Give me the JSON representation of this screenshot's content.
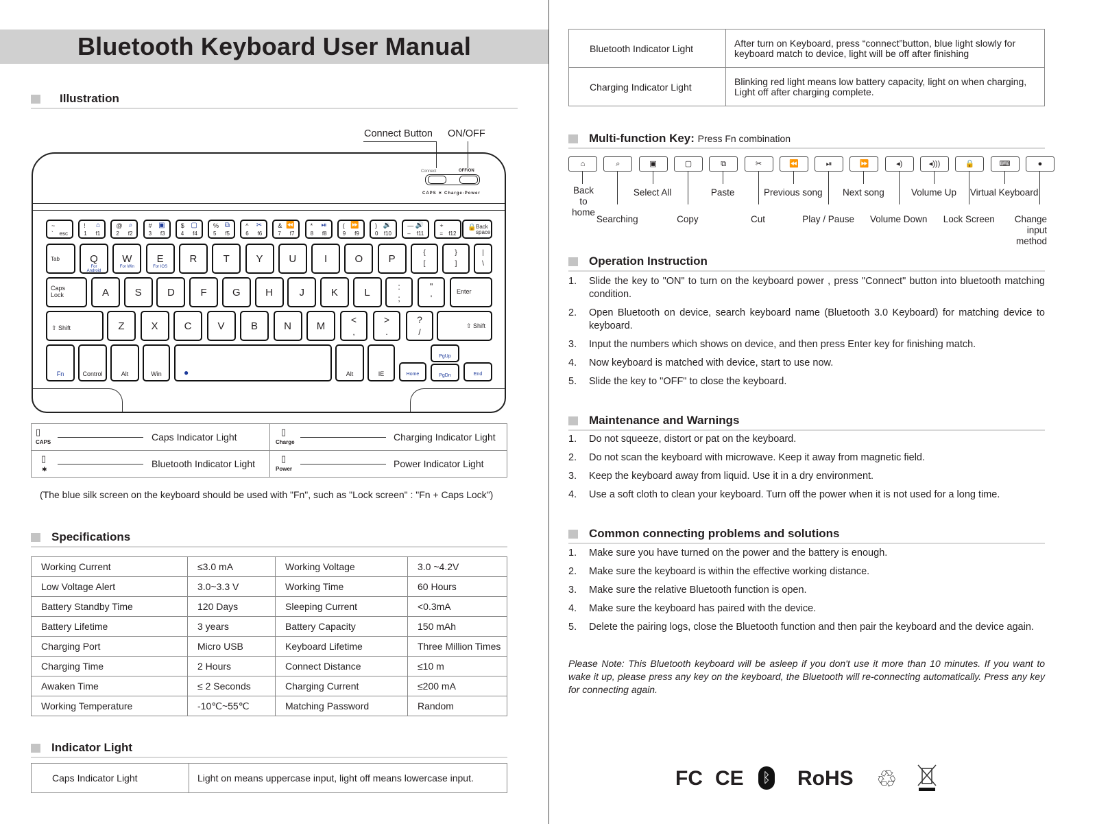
{
  "title": "Bluetooth Keyboard User Manual",
  "sections": {
    "illustration": "Illustration",
    "specifications": "Specifications",
    "indicator_light": "Indicator Light",
    "multi_function": "Multi-function Key:",
    "multi_function_sub": "Press Fn combination",
    "operation": "Operation Instruction",
    "maintenance": "Maintenance and Warnings",
    "problems": "Common connecting problems and solutions"
  },
  "illustration": {
    "callouts": {
      "connect": "Connect Button",
      "onoff": "ON/OFF"
    },
    "device_labels": {
      "connect": "Connect",
      "offon": "OFF/ON",
      "caps": "CAPS",
      "bt": "✶",
      "charge": "Charge",
      "power": "Power"
    },
    "indicator_legend": [
      {
        "code": "CAPS",
        "label": "Caps Indicator Light"
      },
      {
        "code": "Charge",
        "label": "Charging Indicator Light"
      },
      {
        "code": "✱",
        "label": "Bluetooth Indicator Light"
      },
      {
        "code": "Power",
        "label": "Power Indicator Light"
      }
    ],
    "note": "(The blue silk screen on the keyboard should be used with \"Fn\", such as \"Lock screen\" : \"Fn + Caps Lock\")"
  },
  "keyboard": {
    "row1": [
      {
        "top": "~",
        "bot": "`",
        "fn": "esc"
      },
      {
        "top": "!",
        "bot": "1",
        "fn": "f1",
        "icon": "⌂"
      },
      {
        "top": "@",
        "bot": "2",
        "fn": "f2",
        "icon": "⌕"
      },
      {
        "top": "#",
        "bot": "3",
        "fn": "f3",
        "icon": "▣"
      },
      {
        "top": "$",
        "bot": "4",
        "fn": "f4",
        "icon": "▢"
      },
      {
        "top": "%",
        "bot": "5",
        "fn": "f5",
        "icon": "⧉"
      },
      {
        "top": "^",
        "bot": "6",
        "fn": "f6",
        "icon": "✂"
      },
      {
        "top": "&",
        "bot": "7",
        "fn": "f7",
        "icon": "⏪"
      },
      {
        "top": "*",
        "bot": "8",
        "fn": "f8",
        "icon": "⏯"
      },
      {
        "top": "(",
        "bot": "9",
        "fn": "f9",
        "icon": "⏩"
      },
      {
        "top": ")",
        "bot": "0",
        "fn": "f10",
        "icon": "🔉"
      },
      {
        "top": "—",
        "bot": "–",
        "fn": "f11",
        "icon": "🔊"
      },
      {
        "top": "+",
        "bot": "=",
        "fn": "f12"
      }
    ],
    "backspace": "Back space",
    "row2": [
      "Q",
      "W",
      "E",
      "R",
      "T",
      "Y",
      "U",
      "I",
      "O",
      "P"
    ],
    "row2_sub": [
      "For Android",
      "For Win",
      "For IOS"
    ],
    "row2_extra": [
      {
        "top": "{",
        "bot": "["
      },
      {
        "top": "}",
        "bot": "]"
      },
      {
        "top": "|",
        "bot": "\\"
      }
    ],
    "tab": "Tab",
    "row3": [
      "A",
      "S",
      "D",
      "F",
      "G",
      "H",
      "J",
      "K",
      "L"
    ],
    "row3_extra": [
      {
        "top": ":",
        "bot": ";"
      },
      {
        "top": "\"",
        "bot": "'"
      }
    ],
    "caps": "Caps Lock",
    "enter": "Enter",
    "row4": [
      "Z",
      "X",
      "C",
      "V",
      "B",
      "N",
      "M"
    ],
    "row4_extra": [
      {
        "top": "<",
        "bot": ","
      },
      {
        "top": ">",
        "bot": "."
      },
      {
        "top": "?",
        "bot": "/"
      }
    ],
    "shift": "Shift",
    "row5": {
      "fn": "Fn",
      "control": "Control",
      "alt": "Alt",
      "win": "Win",
      "alt2": "Alt",
      "ie": "IE",
      "home": "Home",
      "pgup": "PgUp",
      "pgdn": "PgDn",
      "end": "End"
    }
  },
  "specifications": [
    [
      "Working Current",
      "≤3.0 mA",
      "Working Voltage",
      "3.0 ~4.2V"
    ],
    [
      "Low Voltage Alert",
      "3.0~3.3 V",
      "Working Time",
      "60 Hours"
    ],
    [
      "Battery Standby Time",
      "120 Days",
      "Sleeping Current",
      " <0.3mA"
    ],
    [
      "Battery Lifetime",
      "3 years",
      "Battery Capacity",
      "150 mAh"
    ],
    [
      "Charging Port",
      "Micro USB",
      "Keyboard Lifetime",
      "Three Million Times"
    ],
    [
      "Charging Time",
      "2 Hours",
      "Connect Distance",
      "≤10 m"
    ],
    [
      "Awaken Time",
      "≤ 2 Seconds",
      "Charging Current",
      "≤200 mA"
    ],
    [
      "Working Temperature",
      "-10℃~55℃",
      "Matching Password",
      "Random"
    ]
  ],
  "indicator_table": [
    [
      "Caps Indicator Light",
      "Light on means uppercase input, light off means lowercase input."
    ],
    [
      "Bluetooth Indicator Light",
      "After turn on Keyboard, press “connect”button, blue light slowly for keyboard match to device, light will be off after finishing"
    ],
    [
      "Charging Indicator Light",
      "Blinking red light means low battery capacity, light on when charging, Light off after charging complete."
    ]
  ],
  "multi_function_keys": [
    {
      "icon": "⌂",
      "label": "Back to home",
      "row": "top"
    },
    {
      "icon": "⌕",
      "label": "Searching",
      "row": "bottom"
    },
    {
      "icon": "▣",
      "label": "Select All",
      "row": "top"
    },
    {
      "icon": "▢",
      "label": "Copy",
      "row": "bottom"
    },
    {
      "icon": "⧉",
      "label": "Paste",
      "row": "top"
    },
    {
      "icon": "✂",
      "label": "Cut",
      "row": "bottom"
    },
    {
      "icon": "⏪",
      "label": "Previous song",
      "row": "top"
    },
    {
      "icon": "⏯",
      "label": "Play / Pause",
      "row": "bottom"
    },
    {
      "icon": "⏩",
      "label": "Next song",
      "row": "top"
    },
    {
      "icon": "◂)",
      "label": "Volume Down",
      "row": "bottom"
    },
    {
      "icon": "◂)))",
      "label": "Volume Up",
      "row": "top"
    },
    {
      "icon": "🔒",
      "label": "Lock Screen",
      "row": "bottom"
    },
    {
      "icon": "⌨",
      "label": "Virtual Keyboard",
      "row": "top"
    },
    {
      "icon": "🌐",
      "label": "Change input method",
      "row": "bottom"
    }
  ],
  "operation": [
    "Slide the key to \"ON\" to turn on the keyboard power , press \"Connect\" button into bluetooth matching condition.",
    "Open Bluetooth on device, search keyboard name (Bluetooth 3.0 Keyboard) for matching device to keyboard.",
    "Input the numbers which shows on device, and then press Enter key for finishing match.",
    "Now keyboard is matched with device, start to use now.",
    "Slide the key to \"OFF\" to close the keyboard."
  ],
  "maintenance": [
    "Do not squeeze, distort or pat on the keyboard.",
    "Do not scan the keyboard with microwave. Keep it away from magnetic field.",
    "Keep the keyboard away from liquid. Use it in a dry environment.",
    "Use a soft cloth to clean your keyboard. Turn off the power when it is not used for a long time."
  ],
  "problems": [
    "Make sure you have turned on the power and the battery is enough.",
    "Make sure the keyboard is within the effective working distance.",
    "Make sure the relative Bluetooth function is open.",
    "Make sure the keyboard has paired with the device.",
    "Delete the pairing logs, close the Bluetooth function and then pair the keyboard and the device again."
  ],
  "note": "Please Note: This Bluetooth keyboard will be asleep if you don't use it more than 10 minutes. If you want to wake it up, please press any key on the keyboard, the Bluetooth will re-connecting automatically. Press any key for connecting again.",
  "certifications": [
    "FC",
    "CE",
    "ᛒ",
    "RoHS",
    "♲",
    "WEEE"
  ]
}
